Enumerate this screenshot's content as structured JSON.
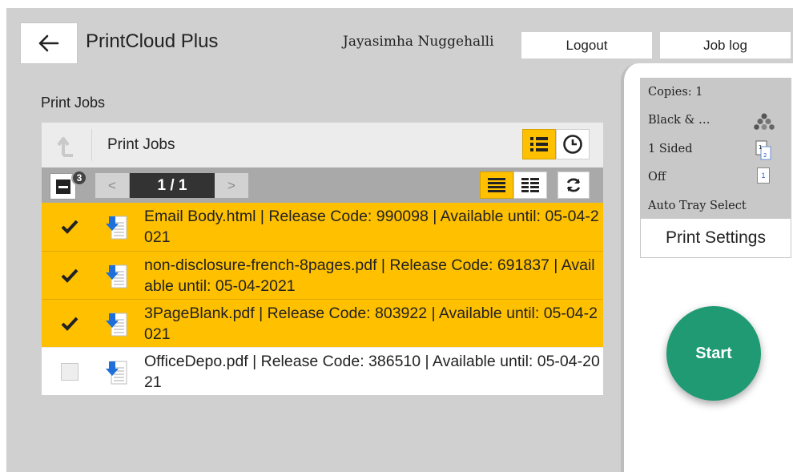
{
  "header": {
    "title": "PrintCloud Plus",
    "user_name": "Jayasimha Nuggehalli",
    "logout_label": "Logout",
    "joblog_label": "Job log"
  },
  "section_label": "Print Jobs",
  "list": {
    "header_title": "Print Jobs",
    "selected_count": "3",
    "page_indicator": "1 / 1",
    "prev_label": "<",
    "next_label": ">",
    "jobs": [
      {
        "text": "Email Body.html | Release Code: 990098 | Available until: 05-04-2021",
        "checked": true
      },
      {
        "text": "non-disclosure-french-8pages.pdf | Release Code: 691837 | Available until: 05-04-2021",
        "checked": true
      },
      {
        "text": "3PageBlank.pdf | Release Code: 803922 | Available until: 05-04-2021",
        "checked": true
      },
      {
        "text": "OfficeDepo.pdf | Release Code: 386510 | Available until: 05-04-2021",
        "checked": false
      }
    ]
  },
  "settings": {
    "copies": "Copies: 1",
    "color": "Black & …",
    "sides": "1 Sided",
    "staple": "Off",
    "tray": "Auto Tray Select",
    "print_settings_label": "Print Settings",
    "nup_value": "1"
  },
  "start_label": "Start",
  "colors": {
    "accent": "#ffc000",
    "start": "#1f9a73",
    "doc_arrow": "#1e6fd9"
  }
}
